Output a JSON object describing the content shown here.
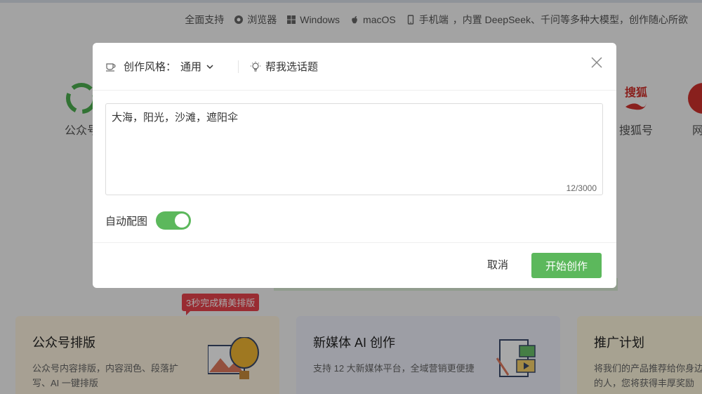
{
  "support_bar": {
    "label": "全面支持",
    "items": [
      {
        "icon": "browser-icon",
        "label": "浏览器"
      },
      {
        "icon": "windows-icon",
        "label": "Windows"
      },
      {
        "icon": "apple-icon",
        "label": "macOS"
      },
      {
        "icon": "phone-icon",
        "label": "手机端"
      }
    ],
    "tagline": "，内置 DeepSeek、千问等多种大模型，创作随心所欲"
  },
  "platforms": [
    {
      "label": "公众号"
    },
    {
      "label": "搜狐号",
      "logo_text": "搜狐"
    },
    {
      "label": "网易"
    }
  ],
  "badge": "3秒完成精美排版",
  "cards": [
    {
      "title": "公众号排版",
      "desc": "公众号内容排版，内容润色、段落扩写、AI 一键排版"
    },
    {
      "title": "新媒体 AI 创作",
      "desc": "支持 12 大新媒体平台，全域营销更便捷"
    },
    {
      "title": "推广计划",
      "desc": "将我们的产品推荐给你身边的人，您将获得丰厚奖励"
    }
  ],
  "modal": {
    "style_label": "创作风格：",
    "style_value": "通用",
    "topic_button": "帮我选话题",
    "input_value": "大海，阳光，沙滩，遮阳伞",
    "char_count": "12/3000",
    "auto_image_label": "自动配图",
    "auto_image_on": true,
    "cancel_label": "取消",
    "start_label": "开始创作"
  },
  "colors": {
    "accent": "#5cb85c",
    "badge": "#e8434d",
    "card1_bg": "#fdf3df",
    "card2_bg": "#eef0fb",
    "card3_bg": "#fdf6dc"
  }
}
